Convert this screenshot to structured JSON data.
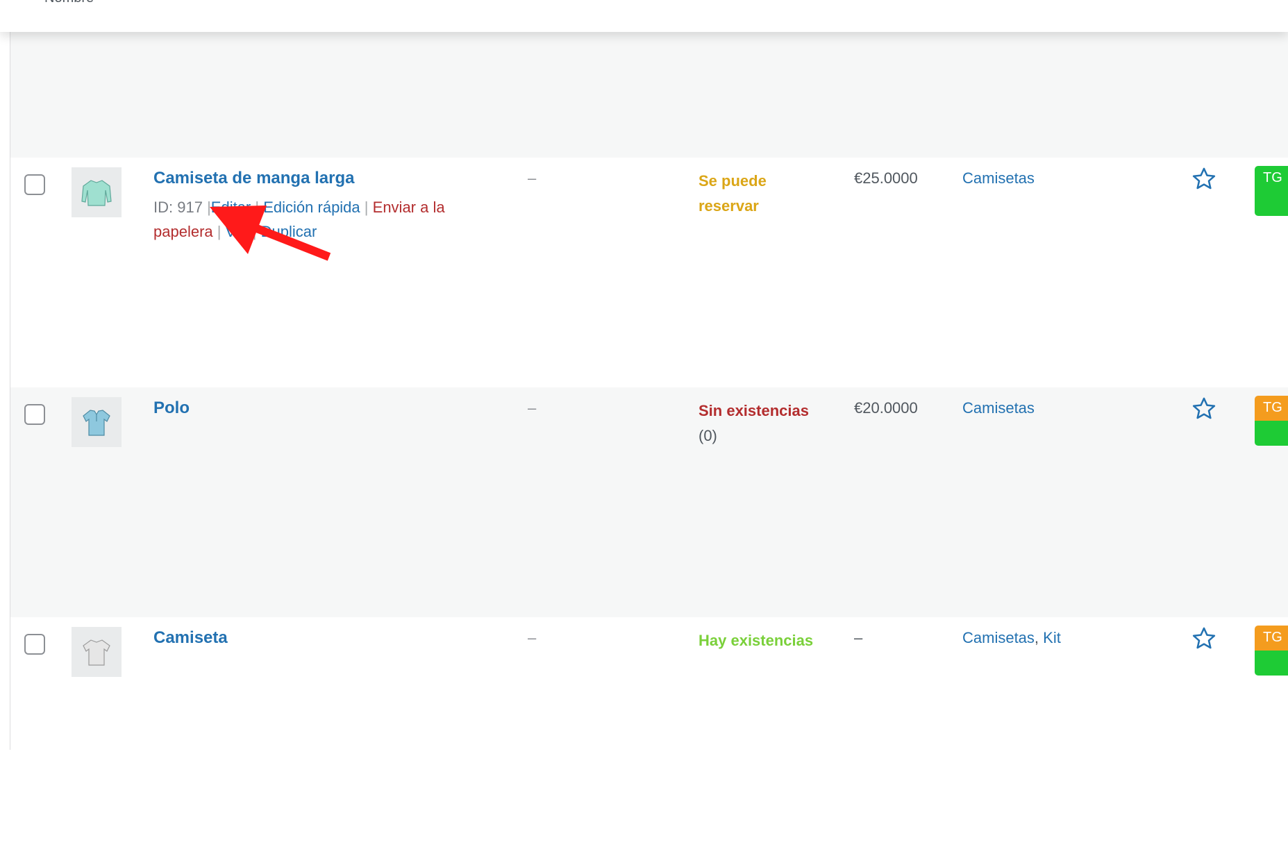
{
  "header": {
    "cut_text": "Nombre"
  },
  "rows": [
    {
      "name": "Camiseta de manga larga",
      "actions": {
        "id": "ID: 917",
        "sep": "|",
        "edit": "Editar",
        "quick_edit": "Edición rápida",
        "trash_line1": "Enviar a la",
        "trash_line2": "papelera",
        "view": "Ver",
        "duplicate": "Duplicar"
      },
      "sku": "–",
      "stock_line1": "Se puede",
      "stock_line2": "reservar",
      "stock_count": "",
      "price": "€25.0000",
      "categories": [
        "Camisetas"
      ],
      "tag": "TG",
      "tag_color": "#1ecb35",
      "stock_color": "#dba617"
    },
    {
      "name": "Polo",
      "sku": "–",
      "stock_line1": "Sin existencias",
      "stock_line2": "",
      "stock_count": "(0)",
      "price": "€20.0000",
      "categories": [
        "Camisetas"
      ],
      "tag": "TG",
      "tag_color": "#f49c1e",
      "stock_color": "#b32d2e"
    },
    {
      "name": "Camiseta",
      "sku": "–",
      "stock_line1": "Hay existencias",
      "stock_line2": "",
      "stock_count": "",
      "price": "–",
      "categories": [
        "Camisetas",
        "Kit"
      ],
      "category_sep": ",",
      "tag": "TG",
      "tag_color": "#f49c1e",
      "stock_color": "#7ad03a"
    }
  ],
  "icons": {
    "star": "star-outline-icon",
    "thumb_1": "long-sleeve-shirt-icon",
    "thumb_2": "polo-shirt-icon",
    "thumb_3": "tshirt-icon",
    "annotation": "red-arrow-icon"
  },
  "colors": {
    "link": "#2271b1",
    "trash": "#b32d2e",
    "arrow": "#ff1a1a"
  }
}
